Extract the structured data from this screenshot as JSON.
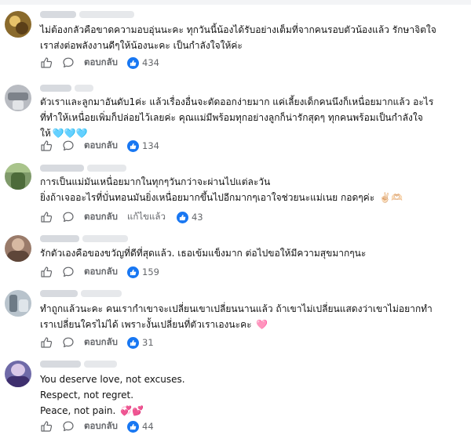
{
  "thread": {
    "comments": [
      {
        "text": "ไม่ต้องกลัวคือขาดความอบอุ่นนะคะ ทุกวันนี้น้องได้รับอย่างเต็มที่จากคนรอบตัวน้องแล้ว รักษาจิตใจ\nเราส่งต่อพลังงานดีๆให้น้องนะคะ เป็นกำลังใจให้ค่ะ",
        "reply_label": "ตอบกลับ",
        "like_count": "434"
      },
      {
        "text": "ตัวเราและลูกมาอันดับ1ค่ะ แล้วเรื่องอื่นจะตัดออกง่ายมาก แค่เลี้ยงเด็กคนนึงก็เหนื่อยมากแล้ว อะไร\nที่ทำให้เหนื่อยเพิ่มก็ปล่อยไว้เลยค่ะ คุณแม่มีพร้อมทุกอย่างลูกก็น่ารักสุดๆ ทุกคนพร้อมเป็นกำลังใจ\nให้",
        "hearts": "🩵🩵🩵",
        "reply_label": "ตอบกลับ",
        "like_count": "134"
      },
      {
        "text": "การเป็นแม่มันเหนื่อยมากในทุกๆวันกว่าจะผ่านไปแต่ละวัน\nยิ่งถ้าเจออะไรที่บั่นทอนมันยิ่งเหนื่อยมากขึ้นไปอีกมากๆเอาใจช่วยนะแม่เนย กอดๆค่ะ",
        "hearts": "✌🏻🫶🏻",
        "reply_label": "ตอบกลับ",
        "edited_label": "แก้ไขแล้ว",
        "like_count": "43"
      },
      {
        "text": "รักตัวเองคือของขวัญที่ดีที่สุดแล้ว. เธอเข้มแข็งมาก ต่อไปขอให้มีความสุขมากๆนะ",
        "reply_label": "ตอบกลับ",
        "like_count": "159"
      },
      {
        "text": "ทำถูกแล้วนะคะ คนเรากำเขาจะเปลี่ยนเขาเปลี่ยนนานแล้ว ถ้าเขาไม่เปลี่ยนแสดงว่าเขาไม่อยากทำ\nเราเปลี่ยนใครไม่ได้ เพราะงั้นเปลี่ยนที่ตัวเราเองนะคะ",
        "hearts": "🩷",
        "reply_label": "ตอบกลับ",
        "like_count": "31"
      },
      {
        "text": "You deserve love, not excuses.\nRespect, not regret.\nPeace, not pain.",
        "hearts": "💞💕",
        "reply_label": "ตอบกลับ",
        "like_count": "44"
      }
    ]
  },
  "colors": {
    "accent": "#1877f2",
    "meta_text": "#65676b",
    "name_placeholder": "#d7dadf"
  }
}
